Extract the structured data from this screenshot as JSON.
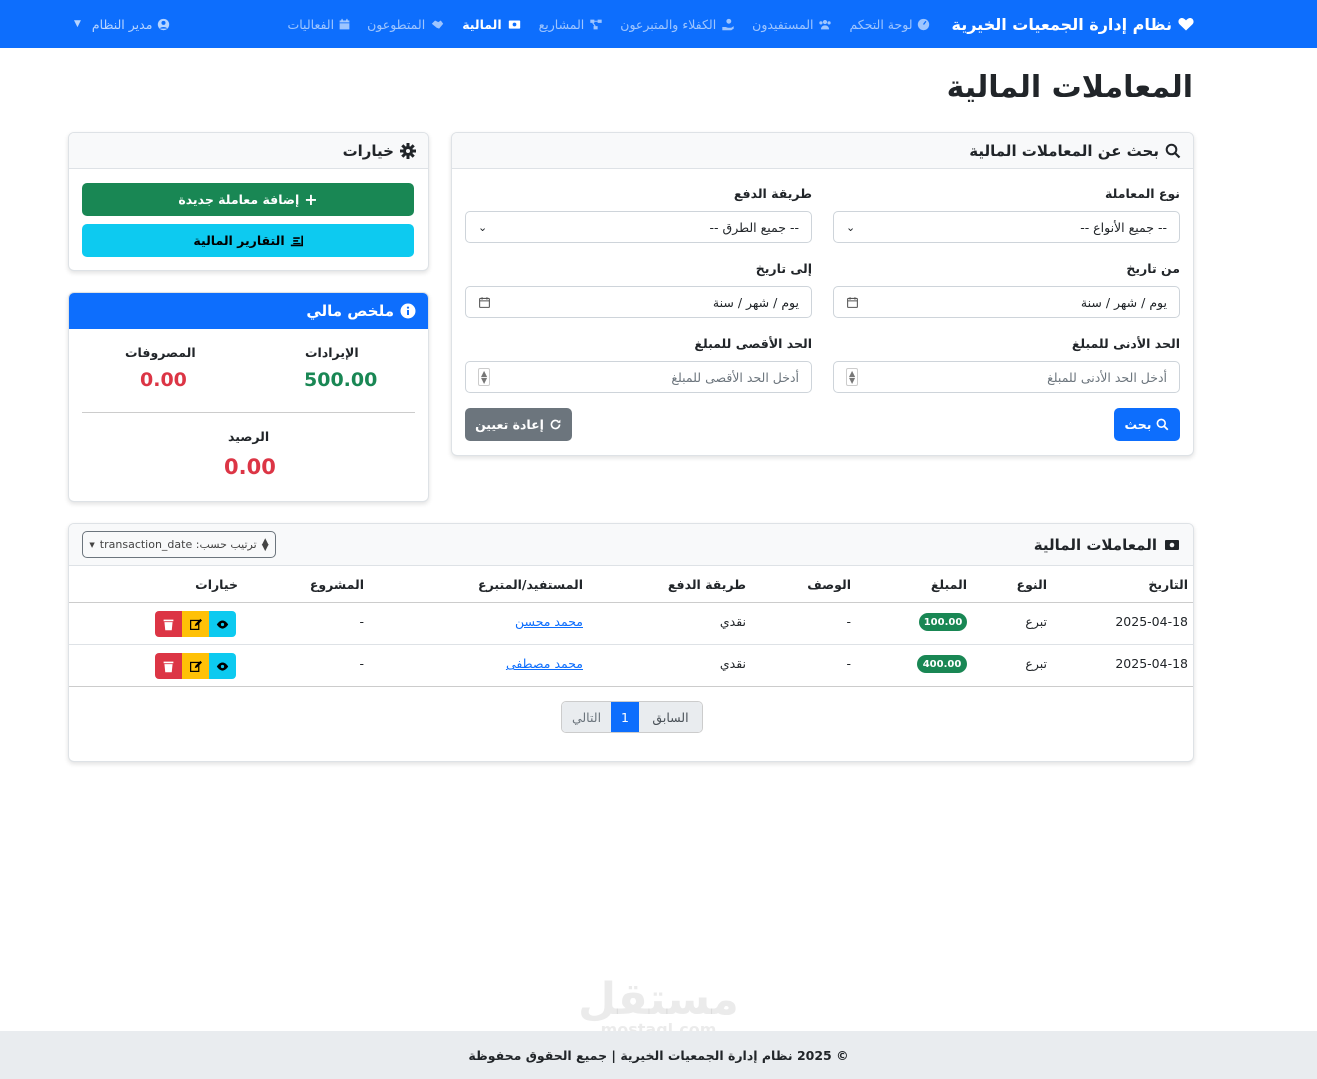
{
  "nav": {
    "brand": "نظام إدارة الجمعيات الخيرية",
    "links": [
      {
        "label": "لوحة التحكم",
        "icon": "gauge-icon"
      },
      {
        "label": "المستفيدون",
        "icon": "users-icon"
      },
      {
        "label": "الكفلاء والمتبرعون",
        "icon": "hand-holding-icon"
      },
      {
        "label": "المشاريع",
        "icon": "project-diagram-icon"
      },
      {
        "label": "المالية",
        "icon": "money-bill-icon"
      },
      {
        "label": "المتطوعون",
        "icon": "handshake-icon"
      },
      {
        "label": "الفعاليات",
        "icon": "calendar-icon"
      }
    ],
    "user": "مدير النظام"
  },
  "page_title": "المعاملات المالية",
  "search": {
    "title": "بحث عن المعاملات المالية",
    "type_label": "نوع المعاملة",
    "type_value": "-- جميع الأنواع --",
    "method_label": "طريقة الدفع",
    "method_value": "-- جميع الطرق --",
    "from_label": "من تاريخ",
    "from_placeholder": "يوم / شهر / سنة",
    "to_label": "إلى تاريخ",
    "to_placeholder": "يوم / شهر / سنة",
    "min_label": "الحد الأدنى للمبلغ",
    "min_placeholder": "أدخل الحد الأدنى للمبلغ",
    "max_label": "الحد الأقصى للمبلغ",
    "max_placeholder": "أدخل الحد الأقصى للمبلغ",
    "search_button": "بحث",
    "reset_button": "إعادة تعيين"
  },
  "options": {
    "title": "خيارات",
    "add_button": "إضافة معاملة جديدة",
    "reports_button": "التقارير المالية"
  },
  "summary": {
    "title": "ملخص مالي",
    "revenue_label": "الإيرادات",
    "revenue_value": "500.00",
    "expenses_label": "المصروفات",
    "expenses_value": "0.00",
    "balance_label": "الرصيد",
    "balance_value": "0.00"
  },
  "table": {
    "title": "المعاملات المالية",
    "sort_label": "ترتيب حسب: transaction_date",
    "headers": [
      "التاريخ",
      "النوع",
      "المبلغ",
      "الوصف",
      "طريقة الدفع",
      "المستفيد/المتبرع",
      "المشروع",
      "خيارات"
    ],
    "rows": [
      {
        "date": "2025-04-18",
        "type": "تبرع",
        "amount": "100.00",
        "desc": "-",
        "method": "نقدي",
        "person": "محمد محسن",
        "project": "-"
      },
      {
        "date": "2025-04-18",
        "type": "تبرع",
        "amount": "400.00",
        "desc": "-",
        "method": "نقدي",
        "person": "محمد مصطفى",
        "project": "-"
      }
    ],
    "pagination": {
      "prev": "السابق",
      "current": "1",
      "next": "التالي"
    }
  },
  "footer": "© 2025 نظام إدارة الجمعيات الخيرية | جميع الحقوق محفوظة",
  "watermark": {
    "ar": "مستقل",
    "en": "mostaql.com"
  },
  "colors": {
    "primary": "#0d6efd",
    "success": "#198754",
    "danger": "#dc3545",
    "info": "#0dcaf0",
    "warning": "#ffc107",
    "secondary": "#6c757d"
  }
}
